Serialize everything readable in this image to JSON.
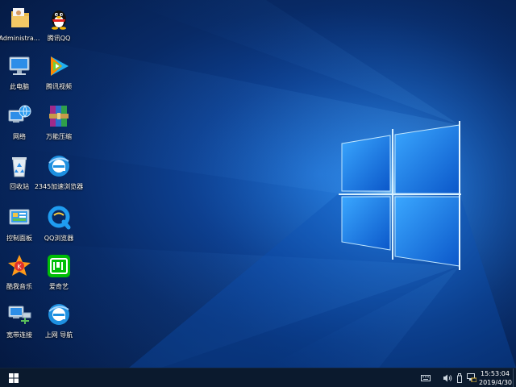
{
  "desktop": {
    "icons": [
      {
        "label": "Administra..."
      },
      {
        "label": "腾讯QQ"
      },
      {
        "label": "此电脑"
      },
      {
        "label": "腾讯视频"
      },
      {
        "label": "网络"
      },
      {
        "label": "万能压缩"
      },
      {
        "label": "回收站"
      },
      {
        "label": "2345加速浏览器"
      },
      {
        "label": "控制面板"
      },
      {
        "label": "QQ浏览器"
      },
      {
        "label": "酷我音乐"
      },
      {
        "label": "爱奇艺"
      },
      {
        "label": "宽带连接"
      },
      {
        "label": "上网 导航"
      }
    ]
  },
  "taskbar": {
    "clock": {
      "time": "15:53:04",
      "date": "2019/4/30"
    },
    "tray_icons": [
      "keyboard-icon",
      "volume-icon",
      "usb-icon",
      "network-icon"
    ]
  },
  "colors": {
    "taskbar": "#0b1a2e",
    "wallpaper_glow": "#4fb0ff",
    "iqiyi_green": "#00be06",
    "ie_blue": "#1e90e0"
  }
}
